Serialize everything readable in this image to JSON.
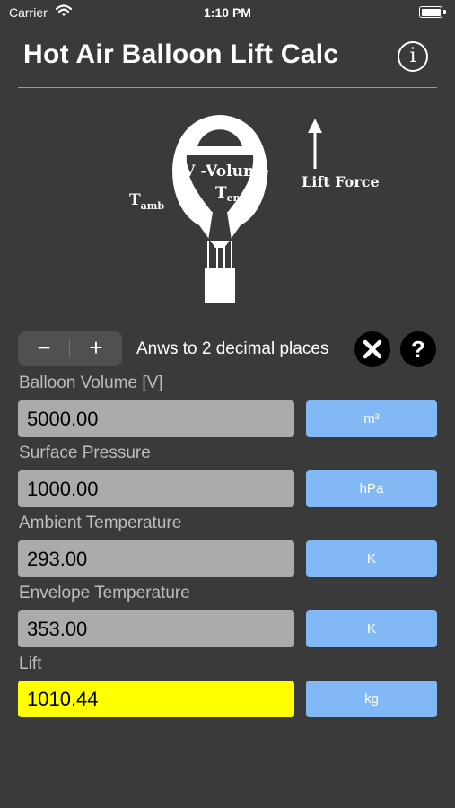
{
  "status_bar": {
    "carrier": "Carrier",
    "time": "1:10 PM"
  },
  "header": {
    "title": "Hot Air Balloon Lift Calc",
    "info_icon": "i"
  },
  "diagram": {
    "volume_label": "V -Volume",
    "t_env_main": "T",
    "t_env_sub": "env",
    "t_amb_main": "T",
    "t_amb_sub": "amb",
    "lift_force_label": "Lift Force"
  },
  "controls": {
    "minus_label": "−",
    "plus_label": "+",
    "precision_text": "Anws to 2 decimal places",
    "help_label": "?"
  },
  "fields": [
    {
      "label": "Balloon Volume [V]",
      "value": "5000.00",
      "unit": "m³"
    },
    {
      "label": "Surface Pressure",
      "value": "1000.00",
      "unit": "hPa"
    },
    {
      "label": "Ambient Temperature",
      "value": "293.00",
      "unit": "K"
    },
    {
      "label": "Envelope Temperature",
      "value": "353.00",
      "unit": "K"
    },
    {
      "label": "Lift",
      "value": "1010.44",
      "unit": "kg"
    }
  ],
  "colors": {
    "background": "#3a3a3a",
    "input_bg": "#ababab",
    "result_bg": "#ffff00",
    "unit_button": "#82b8f5"
  }
}
